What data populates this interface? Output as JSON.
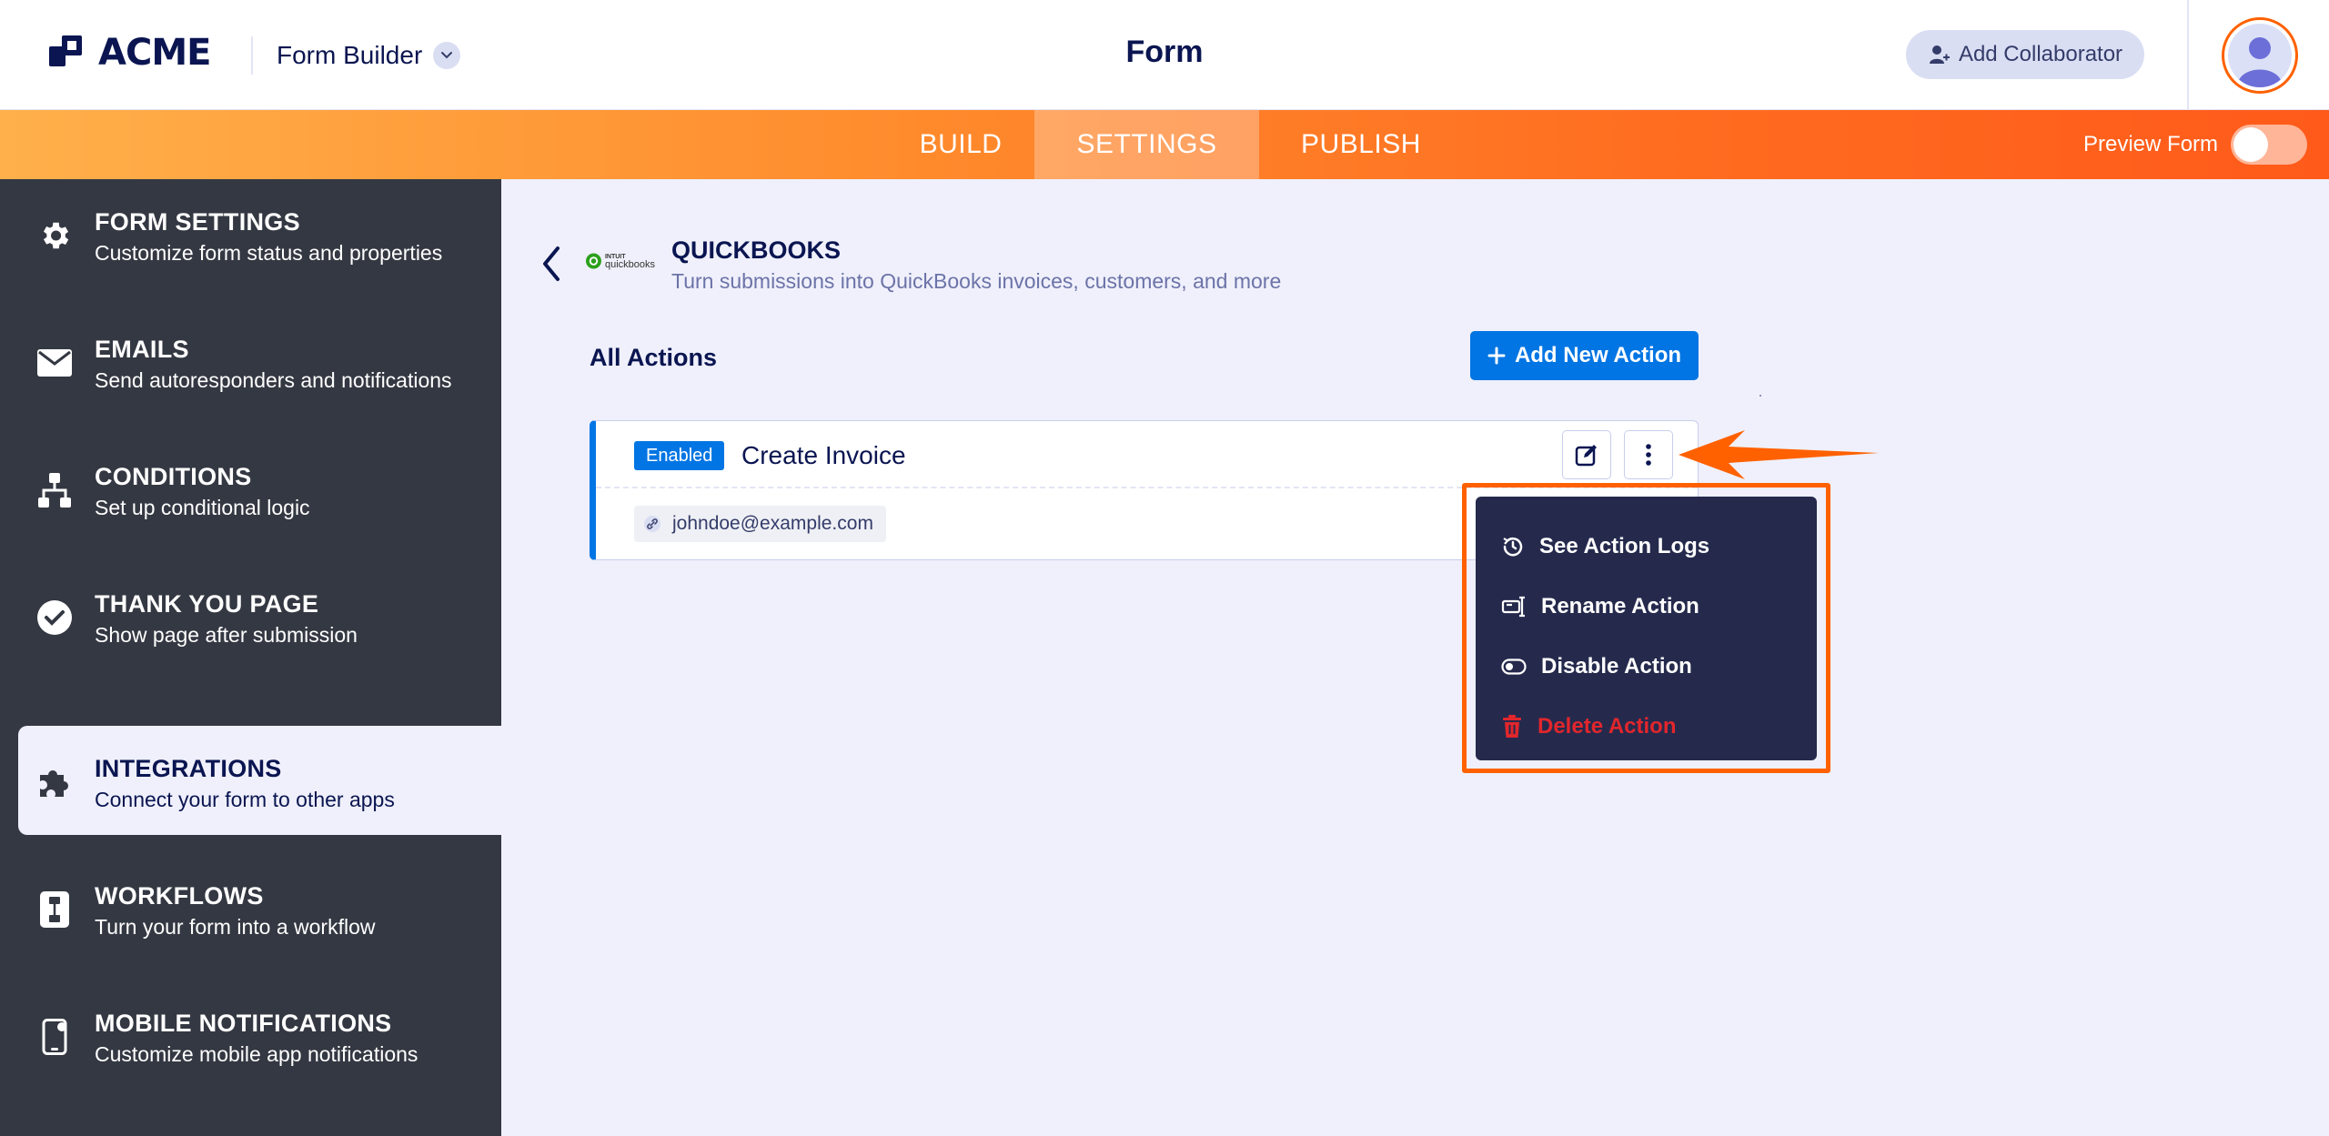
{
  "header": {
    "logo_text": "ACME",
    "builder_label": "Form Builder",
    "page_title": "Form",
    "add_collaborator_label": "Add Collaborator"
  },
  "tabs": [
    {
      "label": "BUILD"
    },
    {
      "label": "SETTINGS",
      "active": true
    },
    {
      "label": "PUBLISH"
    }
  ],
  "preview": {
    "label": "Preview Form",
    "enabled": false
  },
  "sidebar": {
    "items": [
      {
        "title": "FORM SETTINGS",
        "desc": "Customize form status and properties",
        "icon": "gear-icon"
      },
      {
        "title": "EMAILS",
        "desc": "Send autoresponders and notifications",
        "icon": "envelope-icon"
      },
      {
        "title": "CONDITIONS",
        "desc": "Set up conditional logic",
        "icon": "hierarchy-icon"
      },
      {
        "title": "THANK YOU PAGE",
        "desc": "Show page after submission",
        "icon": "check-circle-icon"
      },
      {
        "title": "INTEGRATIONS",
        "desc": "Connect your form to other apps",
        "icon": "puzzle-icon",
        "active": true
      },
      {
        "title": "WORKFLOWS",
        "desc": "Turn your form into a workflow",
        "icon": "workflow-icon"
      },
      {
        "title": "MOBILE NOTIFICATIONS",
        "desc": "Customize mobile app notifications",
        "icon": "mobile-icon"
      }
    ]
  },
  "integration": {
    "logo_small_text": "INTUIT",
    "logo_text": "quickbooks",
    "title": "QUICKBOOKS",
    "description": "Turn submissions into QuickBooks invoices, customers, and more"
  },
  "actions": {
    "heading": "All Actions",
    "add_label": "Add New Action",
    "card": {
      "status": "Enabled",
      "title": "Create Invoice",
      "email": "johndoe@example.com"
    }
  },
  "menu": {
    "items": [
      {
        "label": "See Action Logs",
        "icon": "history-icon"
      },
      {
        "label": "Rename Action",
        "icon": "rename-icon"
      },
      {
        "label": "Disable Action",
        "icon": "toggle-off-icon"
      },
      {
        "label": "Delete Action",
        "icon": "trash-icon",
        "danger": true
      }
    ]
  },
  "colors": {
    "brand_orange": "#ff6100",
    "primary_blue": "#0075e3",
    "navy": "#0a1551",
    "sidebar_bg": "#343842",
    "menu_bg": "#252a4d",
    "danger": "#e1262c"
  }
}
